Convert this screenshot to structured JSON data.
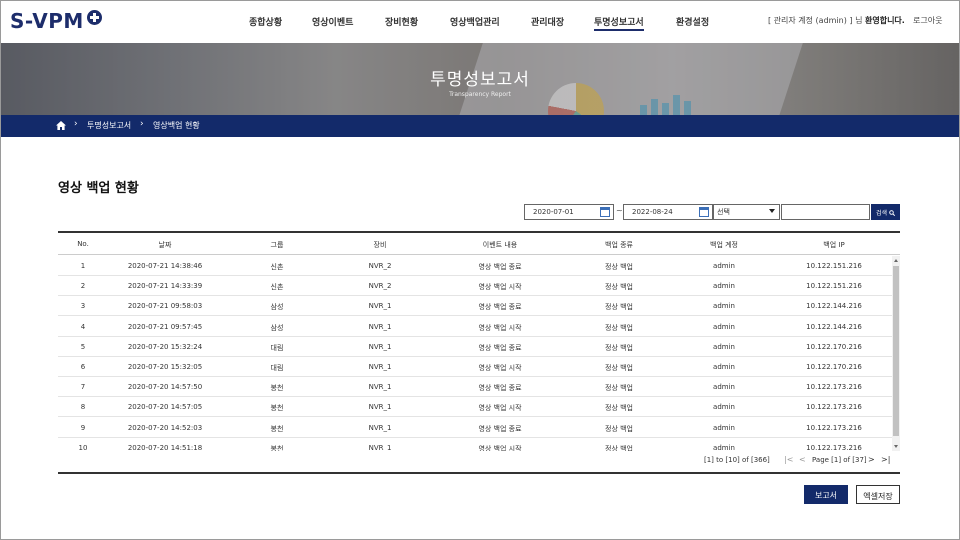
{
  "header": {
    "logo_text": "S-VPM",
    "nav": [
      "종합상황",
      "영상이벤트",
      "장비현황",
      "영상백업관리",
      "관리대장",
      "투명성보고서",
      "환경설정"
    ],
    "active_nav": "투명성보고서",
    "user_prefix": "[ 관리자 계정 (admin) ] 님",
    "user_welcome": "환영합니다.",
    "logout": "로그아웃"
  },
  "banner": {
    "title": "투명성보고서",
    "subtitle": "Transparency Report"
  },
  "breadcrumb": {
    "items": [
      "투명성보고서",
      "영상백업 현황"
    ]
  },
  "page": {
    "title": "영상 백업 현황"
  },
  "search": {
    "date_from": "2020-07-01",
    "tilde": "~",
    "date_to": "2022-08-24",
    "select_value": "선택",
    "keyword": "",
    "button": "검색"
  },
  "table": {
    "columns": [
      "No.",
      "날짜",
      "그룹",
      "장비",
      "이벤트 내용",
      "백업 종류",
      "백업 계정",
      "백업 IP"
    ],
    "rows": [
      [
        "1",
        "2020-07-21 14:38:46",
        "신촌",
        "NVR_2",
        "영상 백업 종료",
        "정상 백업",
        "admin",
        "10.122.151.216"
      ],
      [
        "2",
        "2020-07-21 14:33:39",
        "신촌",
        "NVR_2",
        "영상 백업 시작",
        "정상 백업",
        "admin",
        "10.122.151.216"
      ],
      [
        "3",
        "2020-07-21 09:58:03",
        "삼성",
        "NVR_1",
        "영상 백업 종료",
        "정상 백업",
        "admin",
        "10.122.144.216"
      ],
      [
        "4",
        "2020-07-21 09:57:45",
        "삼성",
        "NVR_1",
        "영상 백업 시작",
        "정상 백업",
        "admin",
        "10.122.144.216"
      ],
      [
        "5",
        "2020-07-20 15:32:24",
        "대림",
        "NVR_1",
        "영상 백업 종료",
        "정상 백업",
        "admin",
        "10.122.170.216"
      ],
      [
        "6",
        "2020-07-20 15:32:05",
        "대림",
        "NVR_1",
        "영상 백업 시작",
        "정상 백업",
        "admin",
        "10.122.170.216"
      ],
      [
        "7",
        "2020-07-20 14:57:50",
        "봉천",
        "NVR_1",
        "영상 백업 종료",
        "정상 백업",
        "admin",
        "10.122.173.216"
      ],
      [
        "8",
        "2020-07-20 14:57:05",
        "봉천",
        "NVR_1",
        "영상 백업 시작",
        "정상 백업",
        "admin",
        "10.122.173.216"
      ],
      [
        "9",
        "2020-07-20 14:52:03",
        "봉천",
        "NVR_1",
        "영상 백업 종료",
        "정상 백업",
        "admin",
        "10.122.173.216"
      ],
      [
        "10",
        "2020-07-20 14:51:18",
        "봉천",
        "NVR_1",
        "영상 백업 시작",
        "정상 백업",
        "admin",
        "10.122.173.216"
      ]
    ]
  },
  "pagination": {
    "range_text": "[1] to [10] of [366]",
    "page_text": "Page [1] of [37]",
    "first": "|<",
    "prev": "<",
    "next": ">",
    "last": ">|"
  },
  "actions": {
    "report": "보고서",
    "excel": "엑셀저장"
  },
  "colors": {
    "navy": "#132a6a",
    "logo": "#1d2d6b"
  }
}
